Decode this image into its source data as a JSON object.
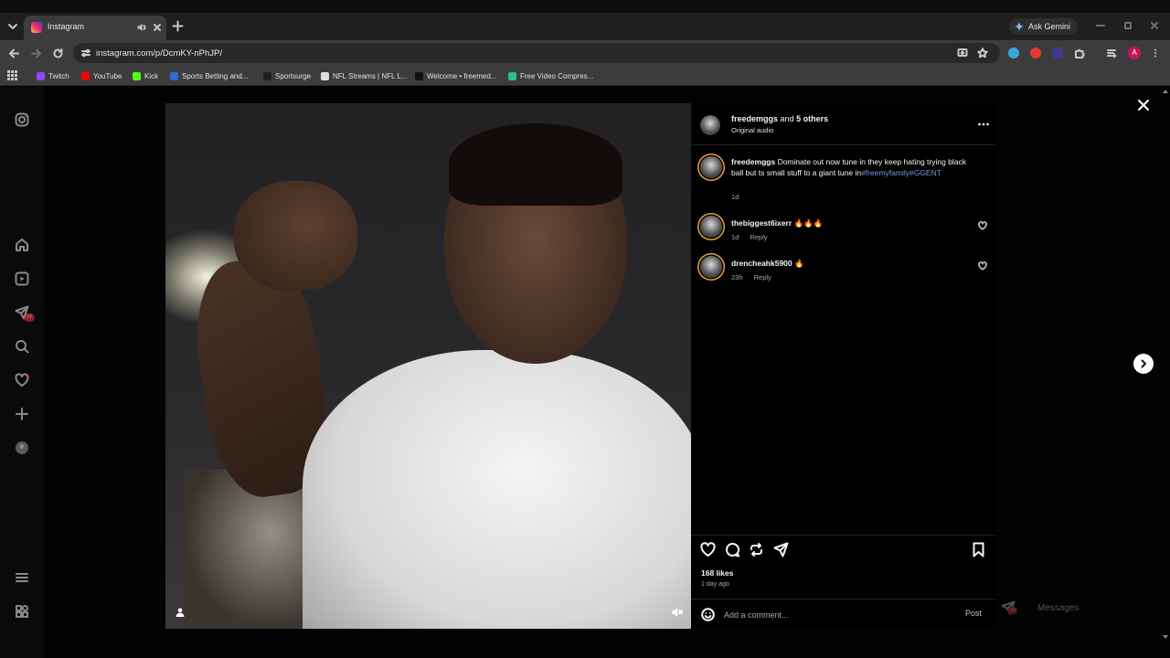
{
  "browser": {
    "tab": {
      "title": "Instagram"
    },
    "gemini_label": "Ask Gemini",
    "url": "instagram.com/p/DcmKY-nPhJP/",
    "profile_initial": "A",
    "bookmarks": [
      {
        "label": "Twitch",
        "color": "#9146ff"
      },
      {
        "label": "YouTube",
        "color": "#ff0000"
      },
      {
        "label": "Kick",
        "color": "#53fc18"
      },
      {
        "label": "Sports Betting and...",
        "color": "#2b6cd8"
      },
      {
        "label": "Sportsurge",
        "color": "#1e1e1e"
      },
      {
        "label": "NFL Streams | NFL L...",
        "color": "#e0e0e0"
      },
      {
        "label": "Welcome • freemed...",
        "color": "#111111"
      },
      {
        "label": "Free Video Compres...",
        "color": "#27c093"
      }
    ]
  },
  "sidebar": {
    "icons": [
      "instagram-icon",
      "home-icon",
      "reels-icon",
      "messages-icon",
      "search-icon",
      "notifications-icon",
      "create-icon",
      "profile-icon",
      "menu-icon",
      "more-apps-icon"
    ],
    "messages_badge": "24"
  },
  "post": {
    "header": {
      "username": "freedemggs",
      "and_text": "and",
      "others": "5 others",
      "audio": "Original audio"
    },
    "caption": {
      "username": "freedemggs",
      "text": "Dominate out now tune in they keep hating trying black ball but ts small stuff to a giant tune in",
      "hashtags": "#freemyfamily#GGENT",
      "time": "1d"
    },
    "comments": [
      {
        "username": "thebiggest6ixerr",
        "text": "🔥🔥🔥",
        "time": "1d",
        "reply": "Reply"
      },
      {
        "username": "drencheahk5900",
        "text": "🔥",
        "time": "23h",
        "reply": "Reply"
      }
    ],
    "likes": "168 likes",
    "posted": "1 day ago",
    "composer": {
      "placeholder": "Add a comment...",
      "post_label": "Post"
    }
  },
  "messages_widget": {
    "label": "Messages",
    "badge": "24"
  }
}
